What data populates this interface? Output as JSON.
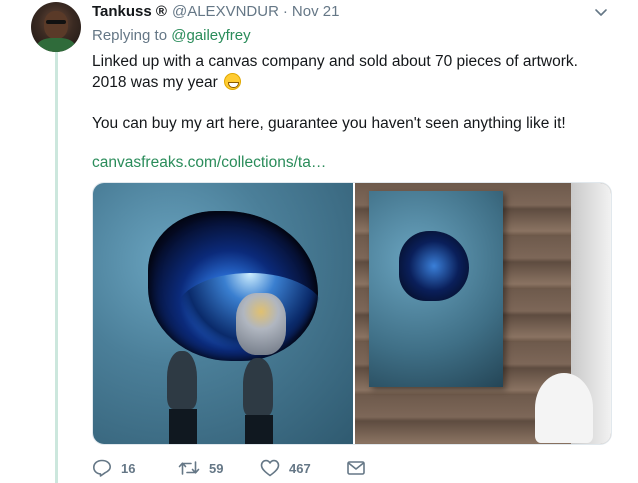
{
  "tweet": {
    "author_name": "Tankuss",
    "author_badge": "®",
    "handle": "@ALEXVNDUR",
    "separator": "·",
    "time": "Nov 21",
    "replying_prefix": "Replying to",
    "replying_to": "@gaileyfrey",
    "text_line1": "Linked up with a canvas company and sold about 70 pieces of artwork. 2018 was my year",
    "text_line2": "You can buy my art here, guarantee you haven't seen anything like it!",
    "link": "canvasfreaks.com/collections/ta…",
    "media": [
      "astronaut-in-pothole-artwork",
      "artwork-canvas-on-wall-mockup"
    ]
  },
  "actions": {
    "reply_count": "16",
    "retweet_count": "59",
    "like_count": "467"
  },
  "icons": {
    "chevron": "chevron-down-icon",
    "reply": "reply-icon",
    "retweet": "retweet-icon",
    "like": "heart-icon",
    "dm": "envelope-icon",
    "emoji": "grinning-face-icon"
  },
  "colors": {
    "accent": "#2a8c5a",
    "muted": "#657786",
    "thread_line": "#cce7dd"
  }
}
